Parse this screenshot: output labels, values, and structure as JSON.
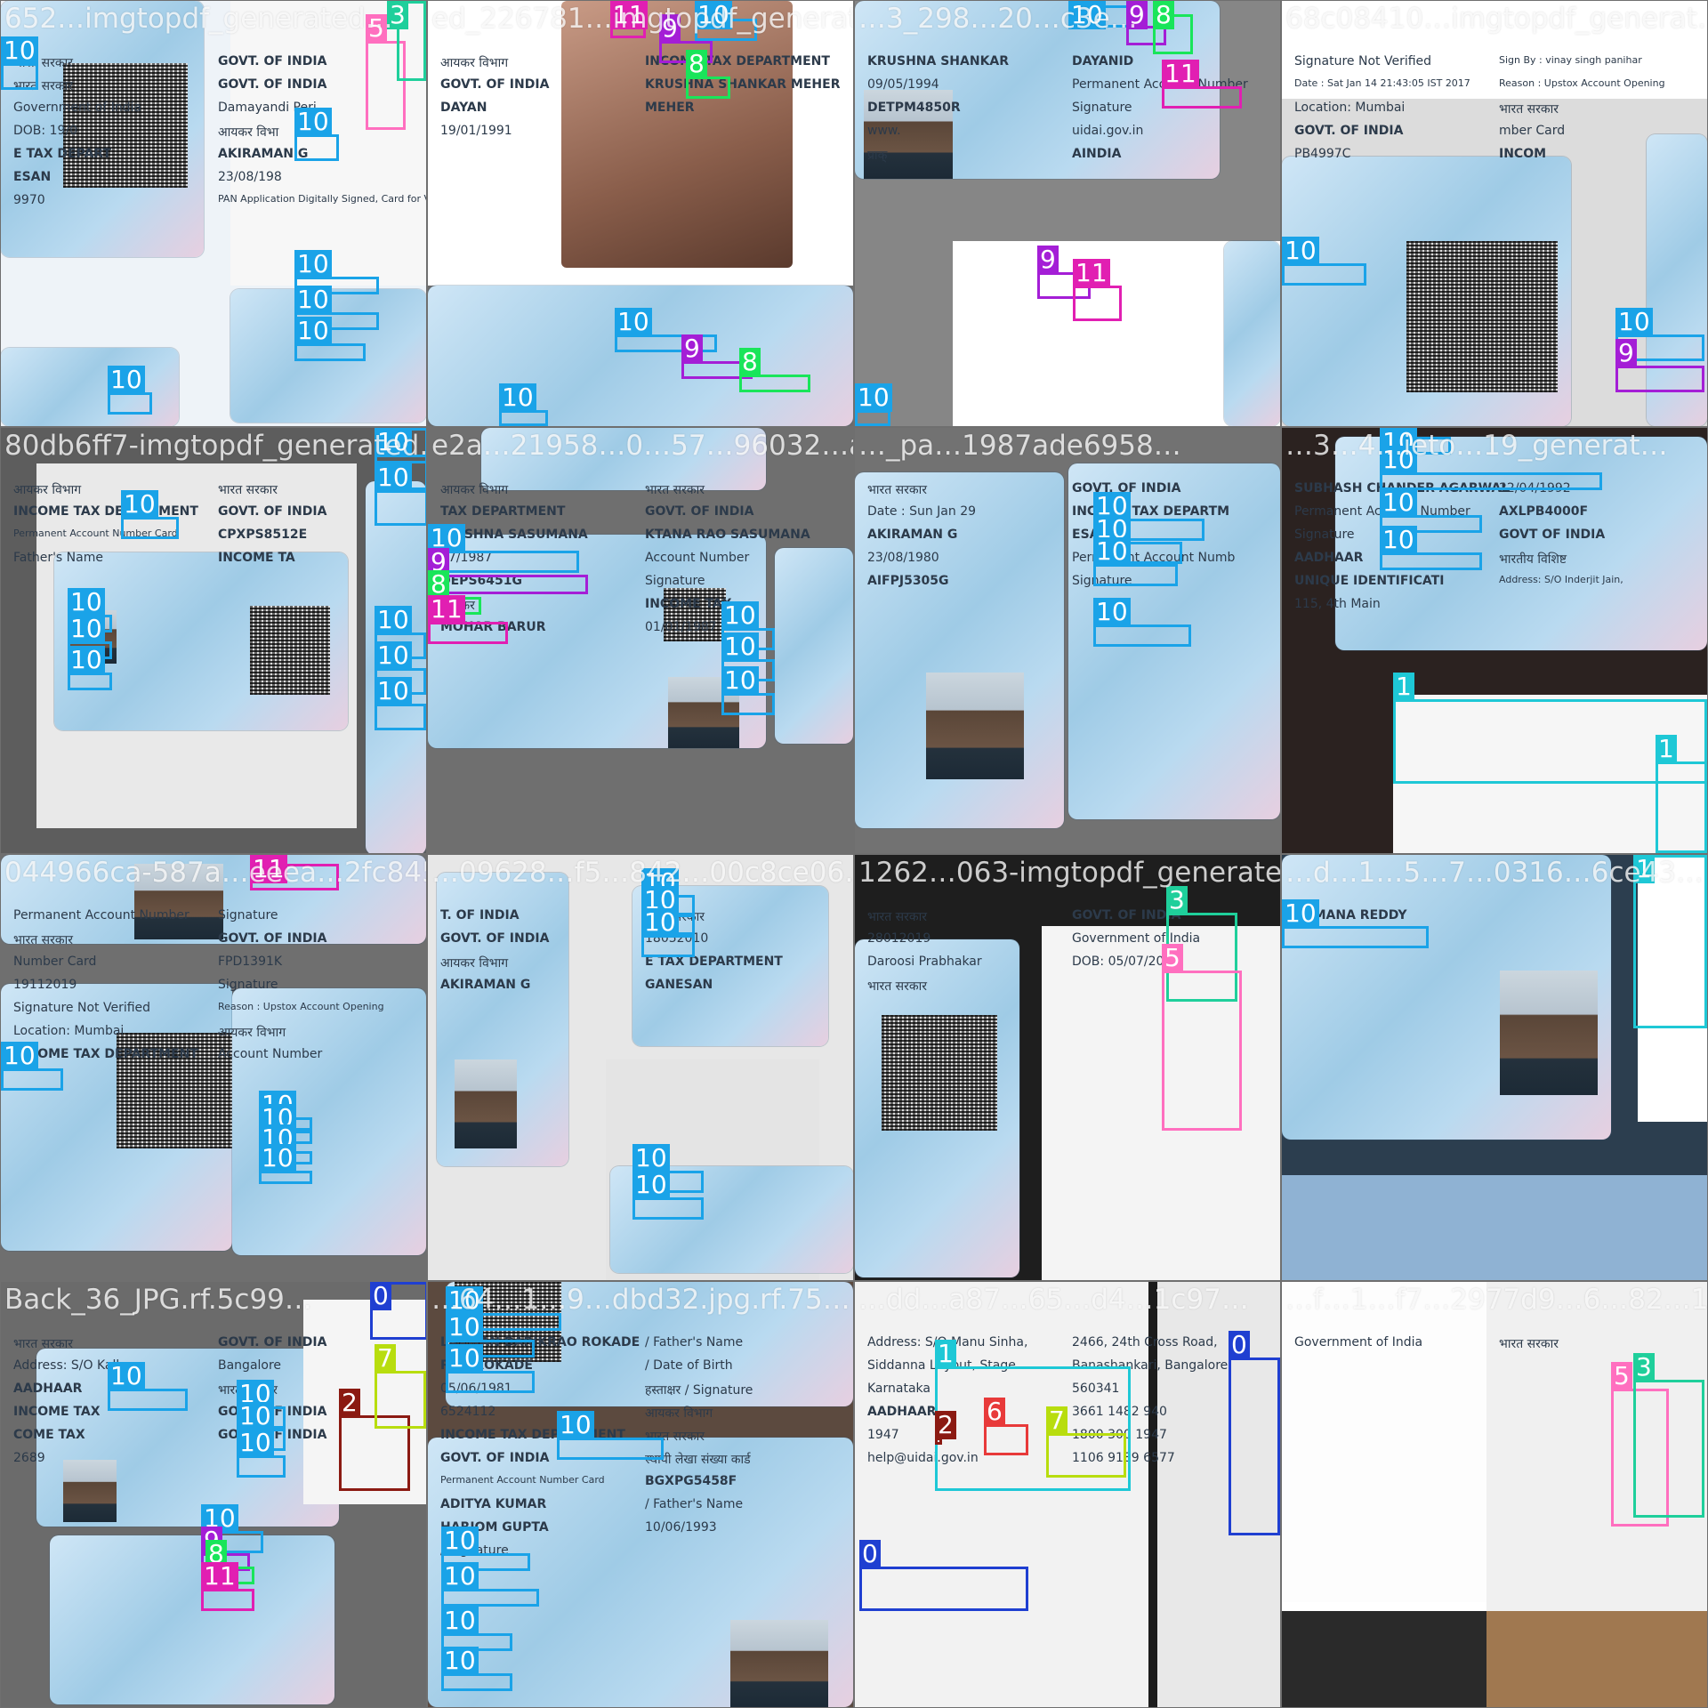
{
  "mosaic": {
    "tiles": [
      {
        "label": "652…imgtopdf_generated…",
        "text": [
          "भारत सरकार",
          "GOVT. OF INDIA",
          "भारत सरकार",
          "GOVT. OF INDIA",
          "Government of India",
          "Damayandi Peri",
          "DOB: 19/0",
          "आयकर विभा",
          "E TAX DEPART",
          "AKIRAMAN G",
          "ESAN",
          "23/08/198",
          "9970",
          "PAN Application Digitally Signed, Card for Valid unless Physically Signed"
        ]
      },
      {
        "label": "ed_226781…imgtopdf_generated…",
        "text": [
          "आयकर विभाग",
          "INCOME TAX DEPARTMENT",
          "GOVT. OF INDIA",
          "KRUSHNA SHANKAR MEHER",
          "DAYAN",
          "MEHER",
          "19/01/1991"
        ]
      },
      {
        "label": "…3_298…20…c3e…",
        "text": [
          "KRUSHNA SHANKAR",
          "DAYANID",
          "09/05/1994",
          "Permanent Account Number",
          "DETPM4850R",
          "Signature",
          "www.",
          "uidai.gov.in",
          "प्राक्",
          "AINDIA"
        ]
      },
      {
        "label": "68c08410…imgtopdf_generat…",
        "text": [
          "Signature Not Verified",
          "Sign By : vinay singh panihar",
          "Date : Sat Jan 14 21:43:05 IST 2017",
          "Reason : Upstox Account Opening",
          "Location: Mumbai",
          "भारत सरकार",
          "GOVT. OF INDIA",
          "mber Card",
          "PB4997C",
          "INCOM"
        ]
      },
      {
        "label": "80db6ff7-imgtopdf_generated…",
        "text": [
          "आयकर विभाग",
          "भारत सरकार",
          "INCOME TAX DEPARTMENT",
          "GOVT. OF INDIA",
          "Permanent Account Number Card",
          "CPXPS8512E",
          "Father's Name",
          "INCOME TA"
        ]
      },
      {
        "label": "e2a…21958…0…57…96032…ac5c…",
        "text": [
          "आयकर विभाग",
          "भारत सरकार",
          "TAX DEPARTMENT",
          "GOVT. OF INDIA",
          "KRISHNA SASUMANA",
          "KTANA RAO SASUMANA",
          "07/1987",
          "Account Number",
          "DEPS6451G",
          "Signature",
          "आयकर",
          "INCOME TAX",
          "MOHAR BARUR",
          "01/01/1987"
        ]
      },
      {
        "label": "…_pa…1987ade6958…",
        "text": [
          "भारत सरकार",
          "GOVT. OF INDIA",
          "Date : Sun Jan 29",
          "INCOME TAX DEPARTM",
          "AKIRAMAN G",
          "ESAN",
          "23/08/1980",
          "Permanent Account Numb",
          "AIFPJ5305G",
          "Signature"
        ]
      },
      {
        "label": "…3…4…ieto…19_generat…",
        "text": [
          "SUBHASH CHANDER AGARWAL",
          "22/04/1992",
          "Permanent Account Number",
          "AXLPB4000F",
          "Signature",
          "GOVT OF INDIA",
          "AADHAAR",
          "भारतीय विशिष्ट",
          "UNIQUE IDENTIFICATI",
          "Address: S/O Inderjit Jain,",
          "115, 4th Main"
        ]
      },
      {
        "label": "044966ca-587a…eeea…2fc845…",
        "text": [
          "Permanent Account Number",
          "Signature",
          "भारत सरकार",
          "GOVT. OF INDIA",
          "Number Card",
          "FPD1391K",
          "19112019",
          "Signature",
          "Signature Not Verified",
          "Reason : Upstox Account Opening",
          "Location: Mumbai",
          "आयकर विभाग",
          "INCOME TAX DEPARTMENT",
          "Account Number"
        ]
      },
      {
        "label": "…09628…f5…842…00c8ce06…",
        "text": [
          "T. OF INDIA",
          "भारत सरकार",
          "GOVT. OF INDIA",
          "18052010",
          "आयकर विभाग",
          "E TAX DEPARTMENT",
          "AKIRAMAN G",
          "GANESAN"
        ]
      },
      {
        "label": "1262…063-imgtopdf_generated…",
        "text": [
          "भारत सरकार",
          "GOVT. OF INDIA",
          "28012019",
          "Government of India",
          "Daroosi Prabhakar",
          "DOB: 05/07/2007",
          "भारत सरकार"
        ]
      },
      {
        "label": "…d…1…5…7…0316…6ce43…",
        "text": [
          "RAMANA REDDY"
        ]
      },
      {
        "label": "Back_36_JPG.rf.5c99…",
        "text": [
          "भारत सरकार",
          "GOVT. OF INDIA",
          "Address: S/O Kalka",
          "Bangalore",
          "AADHAAR",
          "भारत सरकार",
          "INCOME TAX",
          "GOVT. OF INDIA",
          "COME TAX",
          "GOVT. OF INDIA",
          "2689"
        ]
      },
      {
        "label": "…64…1…9…dbd32.jpg.rf.75…",
        "text": [
          "LAXMAN BARIKRAO ROKADE",
          "/ Father's Name",
          "RAO ROKADE",
          "/ Date of Birth",
          "05/06/1981",
          "हस्ताक्षर / Signature",
          "6524112",
          "आयकर विभाग",
          "INCOME TAX DEPARTMENT",
          "भारत सरकार",
          "GOVT. OF INDIA",
          "स्थायी लेखा संख्या कार्ड",
          "Permanent Account Number Card",
          "BGXPG5458F",
          "ADITYA KUMAR",
          "/ Father's Name",
          "HARIOM GUPTA",
          "10/06/1993",
          "/ Signature"
        ]
      },
      {
        "label": "…dd…a87…65…d4…1c97…",
        "text": [
          "Address: S/O Manu Sinha,",
          "2466, 24th Cross Road,",
          "Siddanna Layout, Stage",
          "Banashankari, Bangalore,",
          "Karnataka",
          "560341",
          "AADHAAR",
          "3661 1482 940",
          "1947",
          "1800 300 1947",
          "help@uidai.gov.in",
          "1106 9189 6577"
        ]
      },
      {
        "label": "…f…1…f7…2977d9…6…82…1…5…",
        "text": [
          "Government of India",
          "भारत सरकार"
        ]
      }
    ],
    "class_colors": {
      "0": "#1f3fd1",
      "1": "#1ec8d6",
      "2": "#8b1a12",
      "3": "#1fcf9b",
      "5": "#ff6fbf",
      "6": "#e83a3a",
      "7": "#b8dd0e",
      "8": "#19e55a",
      "9": "#a41ed6",
      "10": "#1aa3e8",
      "11": "#e11fb2"
    },
    "detections": [
      {
        "t": 0,
        "cls": "10"
      },
      {
        "t": 0,
        "cls": "10"
      },
      {
        "t": 0,
        "cls": "10"
      },
      {
        "t": 0,
        "cls": "10"
      },
      {
        "t": 0,
        "cls": "10"
      },
      {
        "t": 0,
        "cls": "5"
      },
      {
        "t": 0,
        "cls": "3"
      },
      {
        "t": 0,
        "cls": "10"
      },
      {
        "t": 1,
        "cls": "11"
      },
      {
        "t": 1,
        "cls": "9"
      },
      {
        "t": 1,
        "cls": "10"
      },
      {
        "t": 1,
        "cls": "8"
      },
      {
        "t": 1,
        "cls": "10"
      },
      {
        "t": 1,
        "cls": "9"
      },
      {
        "t": 1,
        "cls": "8"
      },
      {
        "t": 1,
        "cls": "10"
      },
      {
        "t": 2,
        "cls": "10"
      },
      {
        "t": 2,
        "cls": "9"
      },
      {
        "t": 2,
        "cls": "8"
      },
      {
        "t": 2,
        "cls": "11"
      },
      {
        "t": 2,
        "cls": "9"
      },
      {
        "t": 2,
        "cls": "11"
      },
      {
        "t": 2,
        "cls": "10"
      },
      {
        "t": 3,
        "cls": "10"
      },
      {
        "t": 3,
        "cls": "10"
      },
      {
        "t": 3,
        "cls": "9"
      },
      {
        "t": 4,
        "cls": "10"
      },
      {
        "t": 4,
        "cls": "10"
      },
      {
        "t": 4,
        "cls": "10"
      },
      {
        "t": 4,
        "cls": "10"
      },
      {
        "t": 4,
        "cls": "10"
      },
      {
        "t": 4,
        "cls": "10"
      },
      {
        "t": 4,
        "cls": "10"
      },
      {
        "t": 4,
        "cls": "10"
      },
      {
        "t": 4,
        "cls": "10"
      },
      {
        "t": 4,
        "cls": "10"
      },
      {
        "t": 5,
        "cls": "10"
      },
      {
        "t": 5,
        "cls": "9"
      },
      {
        "t": 5,
        "cls": "8"
      },
      {
        "t": 5,
        "cls": "11"
      },
      {
        "t": 5,
        "cls": "10"
      },
      {
        "t": 5,
        "cls": "10"
      },
      {
        "t": 5,
        "cls": "10"
      },
      {
        "t": 6,
        "cls": "10"
      },
      {
        "t": 6,
        "cls": "10"
      },
      {
        "t": 6,
        "cls": "10"
      },
      {
        "t": 6,
        "cls": "10"
      },
      {
        "t": 7,
        "cls": "10"
      },
      {
        "t": 7,
        "cls": "10"
      },
      {
        "t": 7,
        "cls": "10"
      },
      {
        "t": 7,
        "cls": "10"
      },
      {
        "t": 7,
        "cls": "1"
      },
      {
        "t": 7,
        "cls": "1"
      },
      {
        "t": 8,
        "cls": "11"
      },
      {
        "t": 8,
        "cls": "10"
      },
      {
        "t": 8,
        "cls": "10"
      },
      {
        "t": 8,
        "cls": "10"
      },
      {
        "t": 8,
        "cls": "10"
      },
      {
        "t": 8,
        "cls": "10"
      },
      {
        "t": 9,
        "cls": "10"
      },
      {
        "t": 9,
        "cls": "10"
      },
      {
        "t": 9,
        "cls": "10"
      },
      {
        "t": 9,
        "cls": "10"
      },
      {
        "t": 9,
        "cls": "10"
      },
      {
        "t": 10,
        "cls": "3"
      },
      {
        "t": 10,
        "cls": "5"
      },
      {
        "t": 11,
        "cls": "10"
      },
      {
        "t": 11,
        "cls": "1"
      },
      {
        "t": 12,
        "cls": "10"
      },
      {
        "t": 12,
        "cls": "10"
      },
      {
        "t": 12,
        "cls": "10"
      },
      {
        "t": 12,
        "cls": "10"
      },
      {
        "t": 12,
        "cls": "0"
      },
      {
        "t": 12,
        "cls": "2"
      },
      {
        "t": 12,
        "cls": "7"
      },
      {
        "t": 12,
        "cls": "10"
      },
      {
        "t": 12,
        "cls": "9"
      },
      {
        "t": 12,
        "cls": "8"
      },
      {
        "t": 12,
        "cls": "11"
      },
      {
        "t": 13,
        "cls": "10"
      },
      {
        "t": 13,
        "cls": "10"
      },
      {
        "t": 13,
        "cls": "10"
      },
      {
        "t": 13,
        "cls": "10"
      },
      {
        "t": 13,
        "cls": "10"
      },
      {
        "t": 13,
        "cls": "10"
      },
      {
        "t": 13,
        "cls": "10"
      },
      {
        "t": 13,
        "cls": "10"
      },
      {
        "t": 14,
        "cls": "1"
      },
      {
        "t": 14,
        "cls": "2"
      },
      {
        "t": 14,
        "cls": "6"
      },
      {
        "t": 14,
        "cls": "7"
      },
      {
        "t": 14,
        "cls": "0"
      },
      {
        "t": 14,
        "cls": "0"
      },
      {
        "t": 15,
        "cls": "5"
      },
      {
        "t": 15,
        "cls": "3"
      }
    ]
  }
}
